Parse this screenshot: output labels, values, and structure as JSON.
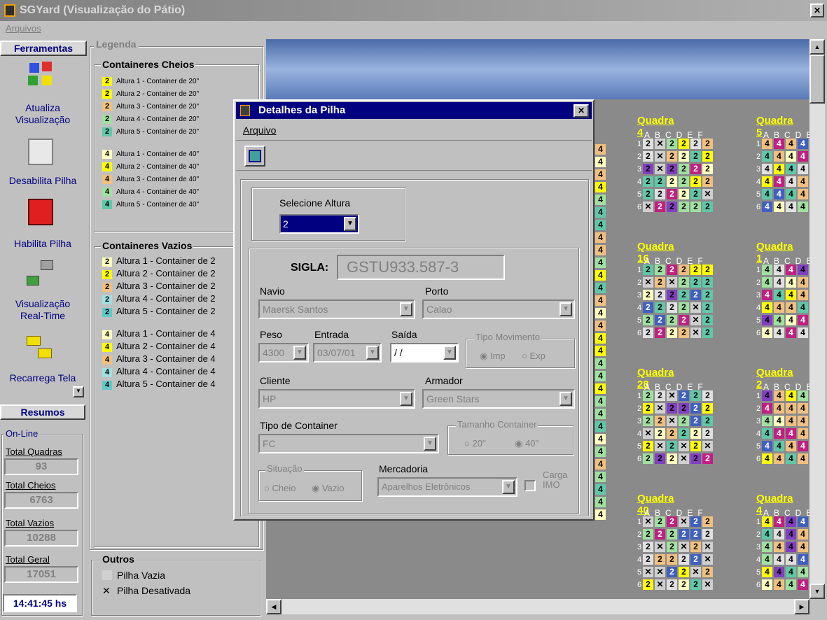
{
  "window": {
    "title": "SGYard (Visualização do Pátio)",
    "close": "✕"
  },
  "menu": {
    "arquivos": "Arquivos"
  },
  "sidebar": {
    "header": "Ferramentas",
    "tools": [
      {
        "label1": "Atualiza",
        "label2": "Visualização"
      },
      {
        "label1": "Desabilita Pilha",
        "label2": ""
      },
      {
        "label1": "Habilita Pilha",
        "label2": ""
      },
      {
        "label1": "Visualização",
        "label2": "Real-Time"
      },
      {
        "label1": "Recarrega Tela",
        "label2": ""
      }
    ],
    "resumos": "Resumos",
    "online": "On-Line",
    "stats": [
      {
        "label": "Total Quadras",
        "value": "93"
      },
      {
        "label": "Total Cheios",
        "value": "6763"
      },
      {
        "label": "Total Vazios",
        "value": "10288"
      },
      {
        "label": "Total Geral",
        "value": "17051"
      }
    ],
    "clock": "14:41:45 hs"
  },
  "legend": {
    "title": "Legenda",
    "cheios_title": "Containeres Cheios",
    "cheios": [
      {
        "n": "2",
        "bg": "#ffff00",
        "t": "Altura 1 - Container de 20\""
      },
      {
        "n": "2",
        "bg": "#ffff00",
        "t": "Altura 2 - Container de 20\""
      },
      {
        "n": "2",
        "bg": "#f0c080",
        "t": "Altura 3 - Container de 20\""
      },
      {
        "n": "2",
        "bg": "#a0e0a0",
        "t": "Altura 4 - Container de 20\""
      },
      {
        "n": "2",
        "bg": "#60c8a8",
        "t": "Altura 5 - Container de 20\""
      },
      {
        "n": "4",
        "bg": "#ffffc0",
        "t": "Altura 1 - Container de 40\""
      },
      {
        "n": "4",
        "bg": "#ffff00",
        "t": "Altura 2 - Container de 40\""
      },
      {
        "n": "4",
        "bg": "#f0c080",
        "t": "Altura 3 - Container de 40\""
      },
      {
        "n": "4",
        "bg": "#a0e0a0",
        "t": "Altura 4 - Container de 40\""
      },
      {
        "n": "4",
        "bg": "#60c8a8",
        "t": "Altura 5 - Container de 40\""
      }
    ],
    "vazios_title": "Containeres Vazios",
    "vazios": [
      {
        "n": "2",
        "bg": "#ffffc0",
        "t": "Altura 1 - Container de 2"
      },
      {
        "n": "2",
        "bg": "#ffff00",
        "t": "Altura 2 - Container de 2"
      },
      {
        "n": "2",
        "bg": "#f0c080",
        "t": "Altura 3 - Container de 2"
      },
      {
        "n": "2",
        "bg": "#a0e0e0",
        "t": "Altura 4 - Container de 2"
      },
      {
        "n": "2",
        "bg": "#60c8c8",
        "t": "Altura 5 - Container de 2"
      },
      {
        "n": "4",
        "bg": "#ffffc0",
        "t": "Altura 1 - Container de 4"
      },
      {
        "n": "4",
        "bg": "#ffff00",
        "t": "Altura 2 - Container de 4"
      },
      {
        "n": "4",
        "bg": "#f0c080",
        "t": "Altura 3 - Container de 4"
      },
      {
        "n": "4",
        "bg": "#a0e0e0",
        "t": "Altura 4 - Container de 4"
      },
      {
        "n": "4",
        "bg": "#60c8c8",
        "t": "Altura 5 - Container de 4"
      }
    ],
    "outros_title": "Outros",
    "pilha_vazia": "Pilha Vazia",
    "pilha_desativada": "Pilha Desativada",
    "x_mark": "✕"
  },
  "yard": {
    "cols": "ABCDEF",
    "quadras": [
      {
        "title": "Quadra 4"
      },
      {
        "title": "Quadra 5"
      },
      {
        "title": "Quadra 16"
      },
      {
        "title": "Quadra 1"
      },
      {
        "title": "Quadra 28"
      },
      {
        "title": "Quadra 2"
      },
      {
        "title": "Quadra 40"
      },
      {
        "title": "Quadra 4"
      }
    ]
  },
  "dialog": {
    "title": "Detalhes da Pilha",
    "close": "✕",
    "menu": "Arquivo",
    "selecione_altura": "Selecione Altura",
    "altura_value": "2",
    "sigla_label": "SIGLA:",
    "sigla_value": "GSTU933.587-3",
    "navio_label": "Navio",
    "navio_value": "Maersk Santos",
    "porto_label": "Porto",
    "porto_value": "Calao",
    "peso_label": "Peso",
    "peso_value": "4300",
    "entrada_label": "Entrada",
    "entrada_value": "03/07/01",
    "saida_label": "Saída",
    "saida_value": " / /",
    "tipo_mov_label": "Tipo Movimento",
    "imp": "Imp",
    "exp": "Exp",
    "cliente_label": "Cliente",
    "cliente_value": "HP",
    "armador_label": "Armador",
    "armador_value": "Green Stars",
    "tipo_container_label": "Tipo de Container",
    "tipo_container_value": "FC",
    "tamanho_label": "Tamanho Container",
    "t20": "20''",
    "t40": "40''",
    "situacao_label": "Situação",
    "cheio": "Cheio",
    "vazio": "Vazio",
    "mercadoria_label": "Mercadoria",
    "mercadoria_value": "Aparelhos Eletrônicos",
    "carga_imo1": "Carga",
    "carga_imo2": "IMO",
    "arrow": "▼"
  },
  "colors": {
    "title_bg": "#808080",
    "yard_bg": "#8a8a8a",
    "dialog_title": "#000080"
  }
}
